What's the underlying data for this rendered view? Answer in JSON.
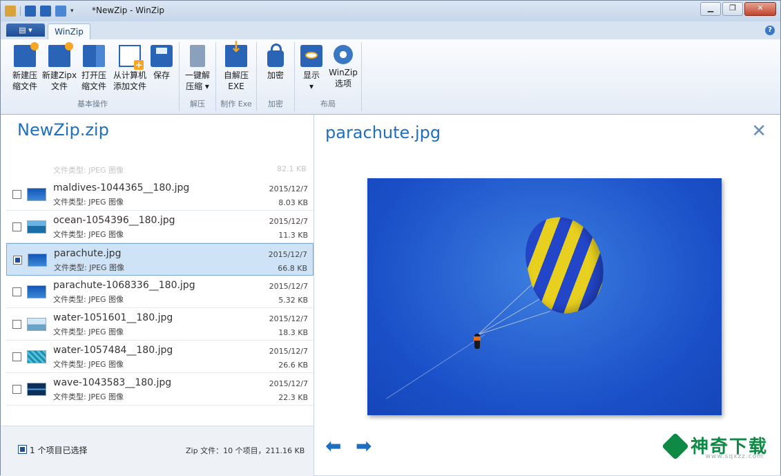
{
  "window": {
    "title": "*NewZip - WinZip"
  },
  "ribbon": {
    "file_menu": "▤ ▾",
    "tab": "WinZip",
    "groups": [
      {
        "label": "基本操作",
        "buttons": [
          {
            "label": "新建压\n缩文件"
          },
          {
            "label": "新建Zipx\n文件"
          },
          {
            "label": "打开压\n缩文件"
          },
          {
            "label": "从计算机\n添加文件"
          },
          {
            "label": "保存"
          }
        ]
      },
      {
        "label": "解压",
        "buttons": [
          {
            "label": "一键解\n压缩 ▾"
          }
        ]
      },
      {
        "label": "制作 Exe",
        "buttons": [
          {
            "label": "自解压\nEXE"
          }
        ]
      },
      {
        "label": "加密",
        "buttons": [
          {
            "label": "加密"
          }
        ]
      },
      {
        "label": "布局",
        "buttons": [
          {
            "label": "显示\n▾"
          },
          {
            "label": "WinZip\n选项"
          }
        ]
      }
    ]
  },
  "left": {
    "zip_name": "NewZip.zip",
    "ghost_row": {
      "type": "文件类型: JPEG 图像",
      "size": "82.1 KB"
    },
    "files": [
      {
        "name": "maldives-1044365__180.jpg",
        "type": "文件类型: JPEG 图像",
        "date": "2015/12/7",
        "size": "8.03 KB",
        "selected": false
      },
      {
        "name": "ocean-1054396__180.jpg",
        "type": "文件类型: JPEG 图像",
        "date": "2015/12/7",
        "size": "11.3 KB",
        "selected": false
      },
      {
        "name": "parachute.jpg",
        "type": "文件类型: JPEG 图像",
        "date": "2015/12/7",
        "size": "66.8 KB",
        "selected": true
      },
      {
        "name": "parachute-1068336__180.jpg",
        "type": "文件类型: JPEG 图像",
        "date": "2015/12/7",
        "size": "5.32 KB",
        "selected": false
      },
      {
        "name": "water-1051601__180.jpg",
        "type": "文件类型: JPEG 图像",
        "date": "2015/12/7",
        "size": "18.3 KB",
        "selected": false
      },
      {
        "name": "water-1057484__180.jpg",
        "type": "文件类型: JPEG 图像",
        "date": "2015/12/7",
        "size": "26.6 KB",
        "selected": false
      },
      {
        "name": "wave-1043583__180.jpg",
        "type": "文件类型: JPEG 图像",
        "date": "2015/12/7",
        "size": "22.3 KB",
        "selected": false
      }
    ],
    "status": {
      "selected": "1 个项目已选择",
      "info": "Zip 文件：10 个项目，211.16 KB"
    }
  },
  "preview": {
    "title": "parachute.jpg",
    "close_glyph": "✕",
    "prev_glyph": "⬅",
    "next_glyph": "➡"
  },
  "watermark": {
    "text": "神奇下载",
    "url": "www.sqxzz.com"
  },
  "colors": {
    "accent": "#1e6fc0",
    "selection": "#cfe3f7",
    "brand_green": "#0f8a45"
  }
}
